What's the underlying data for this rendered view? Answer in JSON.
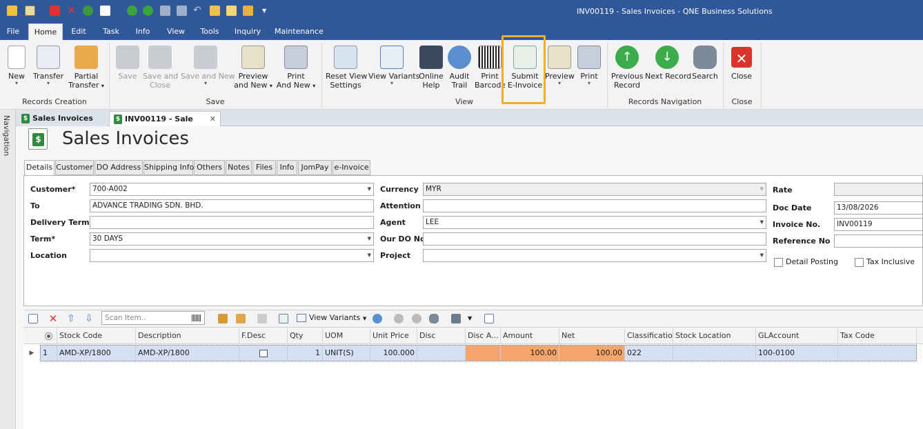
{
  "window": {
    "title": "INV00119 - Sales Invoices - QNE Business Solutions"
  },
  "colors": {
    "title_bar": "#2f579a",
    "highlight": "#f0ad2f",
    "row_selected": "#d5e1f2",
    "amount_cells": "#f6a56a"
  },
  "quick_access": [
    "app-icon",
    "clipboard-icon",
    "pdf-icon",
    "delete-icon",
    "refresh-icon",
    "new-doc-icon",
    "up-icon",
    "down-icon",
    "save-icon",
    "save-all-icon",
    "undo-icon",
    "edit-icon",
    "layout-icon",
    "tools-icon"
  ],
  "menu": {
    "file": "File",
    "home": "Home",
    "edit": "Edit",
    "task": "Task",
    "info": "Info",
    "view": "View",
    "tools": "Tools",
    "inquiry": "Inquiry",
    "maintenance": "Maintenance"
  },
  "ribbon": {
    "new": {
      "l1": "New"
    },
    "transfer": {
      "l1": "Transfer"
    },
    "partial_transfer": {
      "l1": "Partial",
      "l2": "Transfer"
    },
    "save": {
      "l1": "Save"
    },
    "save_close": {
      "l1": "Save and",
      "l2": "Close"
    },
    "save_new": {
      "l1": "Save and New"
    },
    "preview_new": {
      "l1": "Preview",
      "l2": "and New"
    },
    "print_new": {
      "l1": "Print",
      "l2": "And New"
    },
    "reset_view": {
      "l1": "Reset View",
      "l2": "Settings"
    },
    "view_variants": {
      "l1": "View Variants"
    },
    "online_help": {
      "l1": "Online",
      "l2": "Help"
    },
    "audit_trail": {
      "l1": "Audit",
      "l2": "Trail"
    },
    "print_barcode": {
      "l1": "Print",
      "l2": "Barcode"
    },
    "submit_einvoice": {
      "l1": "Submit",
      "l2": "E-Invoice"
    },
    "preview": {
      "l1": "Preview"
    },
    "print": {
      "l1": "Print"
    },
    "previous_record": {
      "l1": "Previous",
      "l2": "Record"
    },
    "next_record": {
      "l1": "Next Record"
    },
    "search": {
      "l1": "Search"
    },
    "close": {
      "l1": "Close"
    },
    "groups": {
      "records_creation": "Records Creation",
      "save": "Save",
      "view": "View",
      "records_navigation": "Records Navigation",
      "close": "Close"
    }
  },
  "navigation_label": "Navigation",
  "doc_tabs": {
    "tab1": "Sales Invoices",
    "tab2": "INV00119 - Sale"
  },
  "page_title": "Sales Invoices",
  "form_tabs": {
    "details": "Details",
    "customer": "Customer",
    "do_address": "DO Address",
    "shipping_info": "Shipping Info",
    "others": "Others",
    "notes": "Notes",
    "files": "Files",
    "info": "Info",
    "jompay": "JomPay",
    "einvoice": "e-Invoice"
  },
  "form": {
    "customer": {
      "label": "Customer*",
      "value": "700-A002"
    },
    "to": {
      "label": "To",
      "value": "ADVANCE TRADING SDN. BHD."
    },
    "delivery_term": {
      "label": "Delivery Term",
      "value": ""
    },
    "term": {
      "label": "Term*",
      "value": "30 DAYS"
    },
    "location": {
      "label": "Location",
      "value": ""
    },
    "currency": {
      "label": "Currency",
      "value": "MYR"
    },
    "attention": {
      "label": "Attention",
      "value": ""
    },
    "agent": {
      "label": "Agent",
      "value": "LEE"
    },
    "our_do_no": {
      "label": "Our DO No",
      "value": ""
    },
    "project": {
      "label": "Project",
      "value": ""
    },
    "rate": {
      "label": "Rate",
      "value": ""
    },
    "doc_date": {
      "label": "Doc Date",
      "value": "13/08/2026"
    },
    "invoice_no": {
      "label": "Invoice No.",
      "value": "INV00119"
    },
    "reference_no": {
      "label": "Reference No",
      "value": ""
    },
    "detail_posting": {
      "label": "Detail Posting",
      "checked": false
    },
    "tax_inclusive": {
      "label": "Tax Inclusive",
      "checked": false
    }
  },
  "grid_toolbar": {
    "scan_placeholder": "Scan Item..",
    "view_variants": "View Variants"
  },
  "grid": {
    "headers": {
      "stock_code": "Stock Code",
      "description": "Description",
      "fdesc": "F.Desc",
      "qty": "Qty",
      "uom": "UOM",
      "unit_price": "Unit Price",
      "disc": "Disc",
      "disc_amt": "Disc A...",
      "amount": "Amount",
      "net": "Net",
      "classification": "Classification",
      "stock_location": "Stock Location",
      "glaccount": "GLAccount",
      "tax_code": "Tax Code"
    },
    "rows": [
      {
        "no": "1",
        "stock_code": "AMD-XP/1800",
        "description": "AMD-XP/1800",
        "qty": "1",
        "uom": "UNIT(S)",
        "unit_price": "100.000",
        "disc": "",
        "disc_amt": "",
        "amount": "100.00",
        "net": "100.00",
        "classification": "022",
        "stock_location": "",
        "glaccount": "100-0100",
        "tax_code": ""
      }
    ]
  }
}
